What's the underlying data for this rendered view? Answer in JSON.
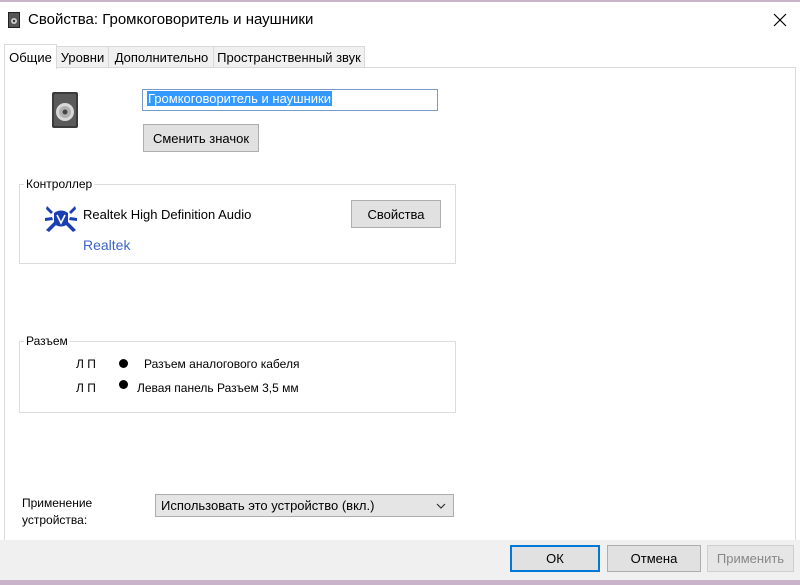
{
  "window": {
    "title": "Свойства: Громкоговоритель и наушники"
  },
  "tabs": [
    {
      "label": "Общие"
    },
    {
      "label": "Уровни"
    },
    {
      "label": "Дополнительно"
    },
    {
      "label": "Пространственный звук"
    }
  ],
  "general": {
    "device_name": "Громкоговоритель и наушники",
    "change_icon_label": "Сменить значок"
  },
  "controller": {
    "group_label": "Контроллер",
    "name": "Realtek High Definition Audio",
    "vendor_link": "Realtek",
    "properties_label": "Свойства"
  },
  "jacks": {
    "group_label": "Разъем",
    "items": [
      {
        "lr": "Л П",
        "label": "Разъем аналогового кабеля"
      },
      {
        "lr": "Л П",
        "label": "Левая панель Разъем 3,5 мм"
      }
    ]
  },
  "usage": {
    "label_line1": "Применение",
    "label_line2": "устройства:",
    "selected": "Использовать это устройство (вкл.)"
  },
  "footer": {
    "ok_label": "ОК",
    "cancel_label": "Отмена",
    "apply_label": "Применить"
  },
  "colors": {
    "link": "#3c64c8",
    "selection": "#3399ff",
    "ok_border": "#0078d7"
  },
  "icons": [
    "speaker-icon",
    "close-icon",
    "speaker-device-icon",
    "realtek-crab-icon",
    "chevron-down-icon"
  ]
}
